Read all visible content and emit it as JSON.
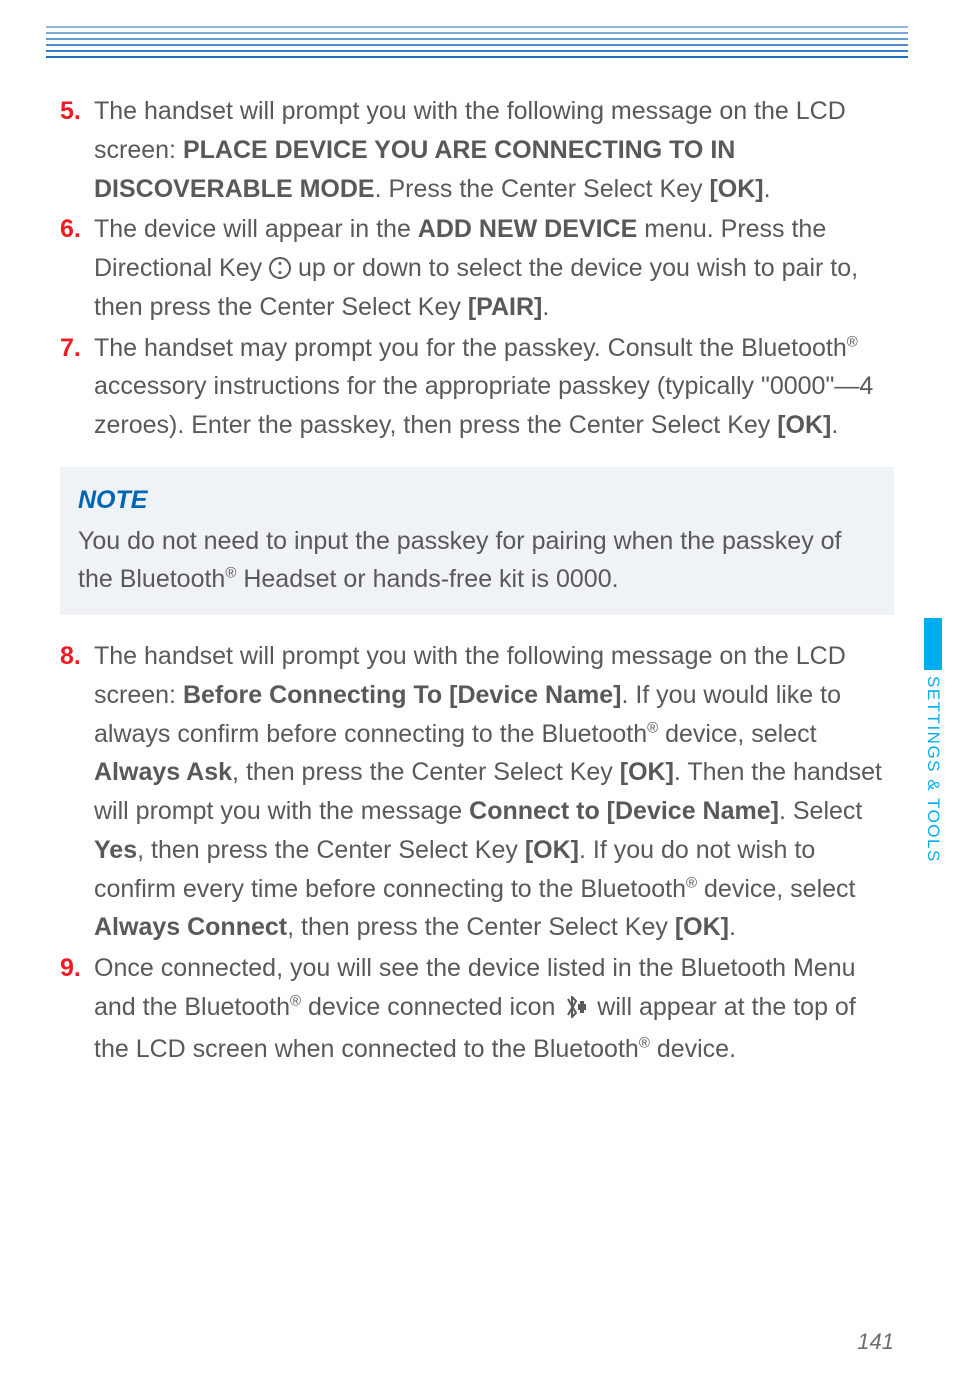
{
  "header_bars": [
    "#93b8e0",
    "#7ba9d9",
    "#649bd2",
    "#4c8ccb",
    "#357ec4",
    "#1d6fbd"
  ],
  "steps": {
    "5": {
      "num": "5.",
      "t1": "The handset will prompt you with the following message on the LCD screen: ",
      "b1": "PLACE DEVICE YOU ARE CONNECTING TO IN DISCOVERABLE MODE",
      "t2": ". Press the Center Select Key ",
      "b2": "[OK]",
      "t3": "."
    },
    "6": {
      "num": "6.",
      "t1": "The device will appear in the ",
      "b1": "ADD NEW DEVICE",
      "t2": " menu. Press the Directional Key ",
      "t3": " up or down to select the device you wish to pair to, then press the Center Select Key ",
      "b2": "[PAIR]",
      "t4": "."
    },
    "7": {
      "num": "7.",
      "t1": "The handset may prompt you for the passkey. Consult the Bluetooth",
      "sup1": "®",
      "t2": " accessory instructions for the appropriate passkey (typically \"0000\"—4 zeroes). Enter the passkey, then press the Center Select Key ",
      "b1": "[OK]",
      "t3": "."
    },
    "8": {
      "num": "8.",
      "t1": "The handset will prompt you with the following message on the LCD screen: ",
      "b1": "Before Connecting To [Device Name]",
      "t2": ". If you would like to always confirm before connecting to the Bluetooth",
      "sup1": "®",
      "t3": " device, select ",
      "b2": "Always Ask",
      "t4": ", then press the Center Select Key ",
      "b3": "[OK]",
      "t5": ". Then the handset will prompt you with the message ",
      "b4": "Connect to [Device Name]",
      "t6": ". Select ",
      "b5": "Yes",
      "t7": ", then press the Center Select Key ",
      "b6": "[OK]",
      "t8": ". If you do not wish to confirm every time before connecting to the Bluetooth",
      "sup2": "®",
      "t9": " device, select ",
      "b7": "Always Connect",
      "t10": ", then press the Center Select Key ",
      "b8": "[OK]",
      "t11": "."
    },
    "9": {
      "num": "9.",
      "t1": "Once connected, you will see the device listed in the Bluetooth Menu and the Bluetooth",
      "sup1": "®",
      "t2": " device connected icon ",
      "t3": " will appear at the top of the LCD screen when connected to the Bluetooth",
      "sup2": "®",
      "t4": " device."
    }
  },
  "note": {
    "title": "NOTE",
    "t1": "You do not need to input the passkey for pairing when the passkey of the Bluetooth",
    "sup1": "®",
    "t2": " Headset or hands-free kit is 0000."
  },
  "side_label": "SETTINGS & TOOLS",
  "page_number": "141"
}
